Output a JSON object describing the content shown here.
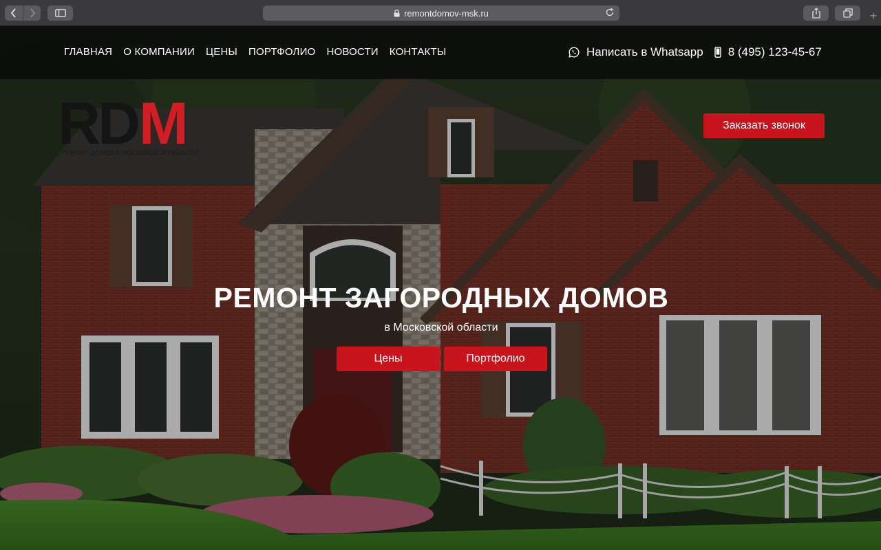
{
  "browser": {
    "url": "remontdomov-msk.ru"
  },
  "nav": {
    "items": [
      "ГЛАВНАЯ",
      "О КОМПАНИИ",
      "ЦЕНЫ",
      "ПОРТФОЛИО",
      "НОВОСТИ",
      "КОНТАКТЫ"
    ]
  },
  "contacts": {
    "whatsapp_label": "Написать в Whatsapp",
    "phone": "8 (495) 123-45-67"
  },
  "logo": {
    "letters_dark": "RD",
    "letter_red": "M",
    "subtitle": "РЕМОНТ ДОМОВ В МОСКОВСКОЙ ОБЛАСТИ"
  },
  "call_button": "Заказать звонок",
  "hero": {
    "title": "РЕМОНТ ЗАГОРОДНЫХ ДОМОВ",
    "subtitle": "в Московской области",
    "buttons": [
      "Цены",
      "Портфолио"
    ]
  },
  "colors": {
    "accent_red": "#c8141c",
    "header_bg": "#0a0a0a"
  }
}
